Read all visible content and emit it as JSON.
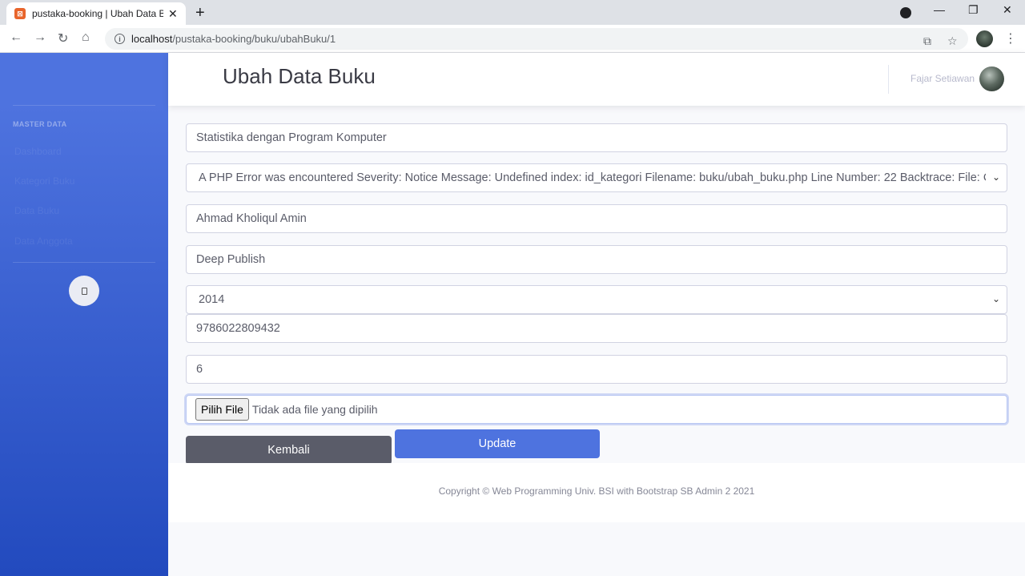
{
  "browser": {
    "tab_title": "pustaka-booking | Ubah Data Buku",
    "tab_favicon": "xampp-logo-icon",
    "url_host": "localhost",
    "url_path": "/pustaka-booking/buku/ubahBuku/1"
  },
  "sidebar": {
    "heading": "MASTER DATA",
    "items": [
      {
        "label": "Dashboard"
      },
      {
        "label": "Kategori Buku"
      },
      {
        "label": "Data Buku"
      },
      {
        "label": "Data Anggota"
      }
    ]
  },
  "topbar": {
    "title": "Ubah Data Buku",
    "user_name": "Fajar Setiawan"
  },
  "form": {
    "judul": "Statistika dengan Program Komputer",
    "kategori": "A PHP Error was encountered Severity: Notice Message: Undefined index: id_kategori Filename: buku/ubah_buku.php Line Number: 22 Backtrace: File: C:\\xampp\\htdocs\\pustaka-booking\\application\\views\\buku\\ubah_buku.php",
    "pengarang": "Ahmad Kholiqul Amin",
    "penerbit": "Deep Publish",
    "tahun": "2014",
    "isbn": "9786022809432",
    "stok": "6",
    "file_button": "Pilih File",
    "file_status": "Tidak ada file yang dipilih"
  },
  "buttons": {
    "back": "Kembali",
    "update": "Update"
  },
  "footer": {
    "copyright": "Copyright © Web Programming Univ. BSI with Bootstrap SB Admin 2 2021"
  }
}
